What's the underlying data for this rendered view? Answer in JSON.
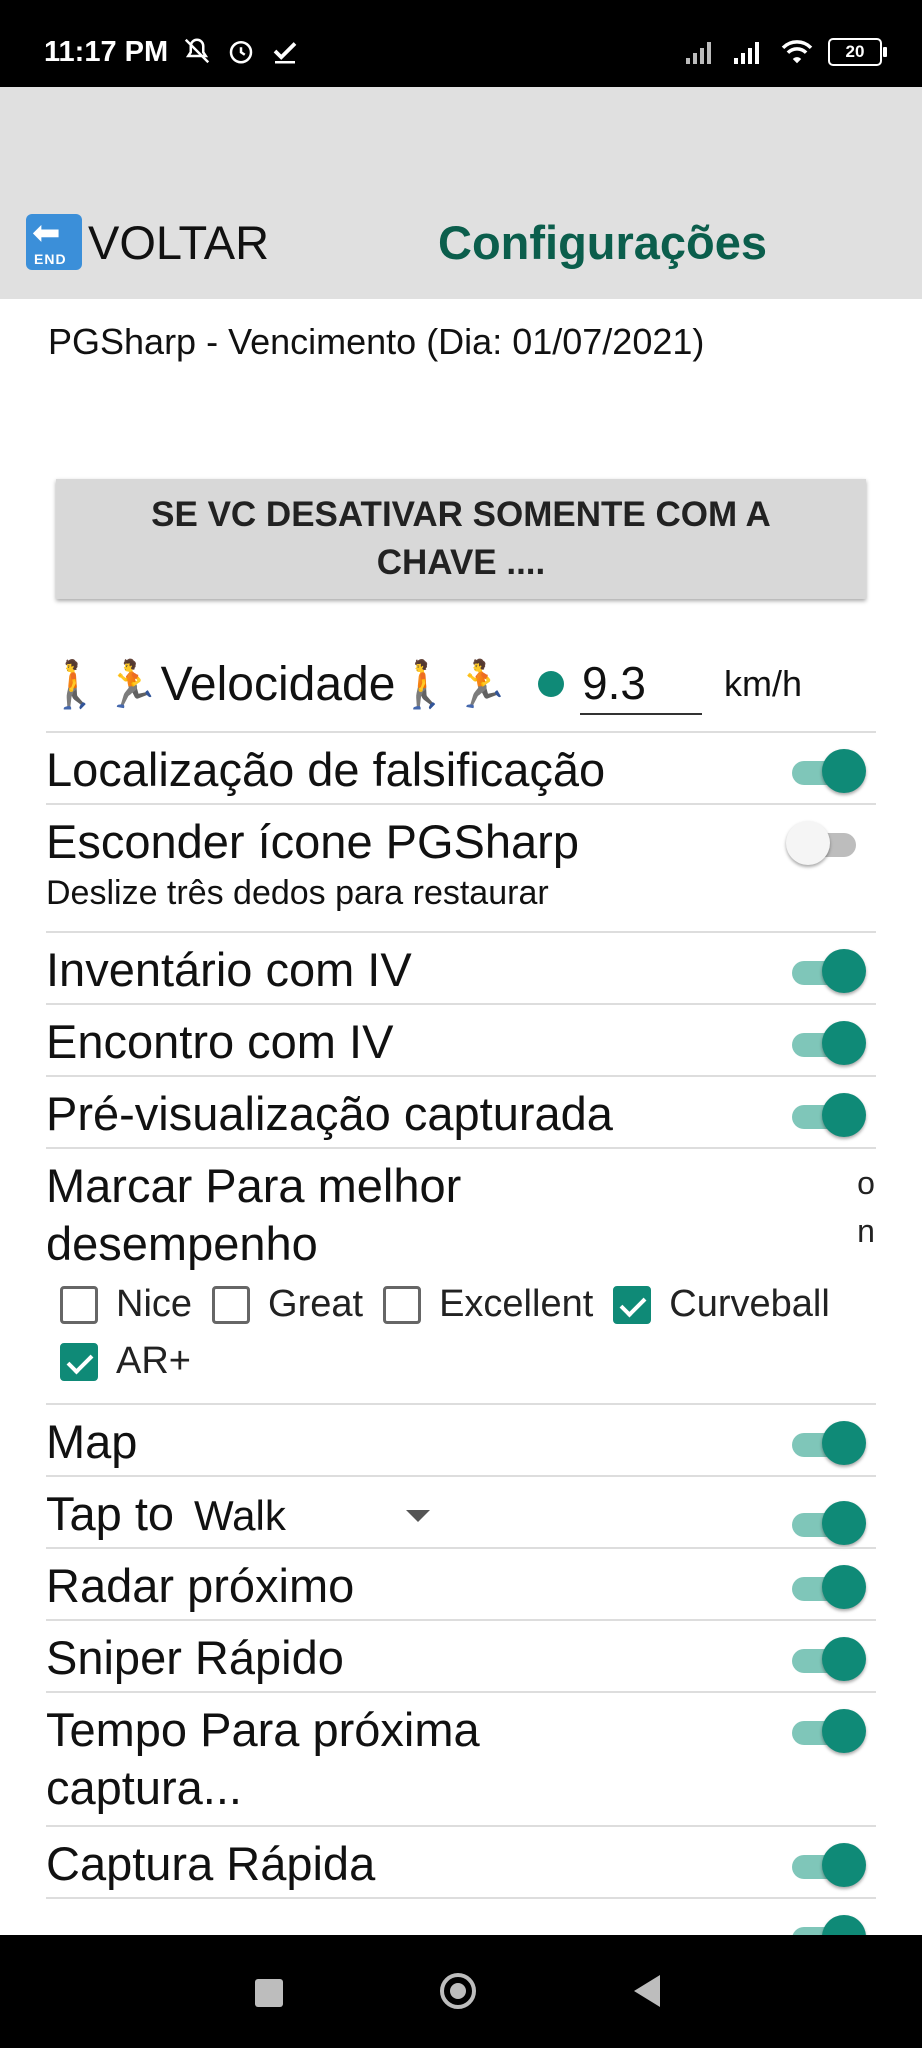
{
  "status": {
    "time": "11:17 PM",
    "battery": "20",
    "icons_left": [
      "muted-icon",
      "alarm-icon",
      "check-icon"
    ],
    "icons_right": [
      "signal-icon",
      "signal-icon",
      "wifi-icon",
      "battery-icon"
    ]
  },
  "header": {
    "back_icon_text": "END",
    "back_label": "VOLTAR",
    "title": "Configurações"
  },
  "content": {
    "expiry": "PGSharp - Vencimento (Dia: 01/07/2021)",
    "deactivate_button": "SE VC DESATIVAR SOMENTE COM A CHAVE ....",
    "speed": {
      "label": "Velocidade",
      "value": "9.3",
      "unit": "km/h"
    },
    "rows": {
      "spoof": {
        "label": "Localização de falsificação",
        "on": true
      },
      "hide_icon": {
        "label": "Esconder ícone PGSharp",
        "sub": "Deslize três dedos para restaurar",
        "on": false
      },
      "inventory_iv": {
        "label": "Inventário com IV",
        "on": true
      },
      "encounter_iv": {
        "label": "Encontro com  IV",
        "on": true
      },
      "preview": {
        "label": "Pré-visualização capturada",
        "on": true
      },
      "mark": {
        "label": "Marcar Para melhor desempenho",
        "on_text": "o\nn"
      },
      "map": {
        "label": "Map",
        "on": true
      },
      "tap_to": {
        "label": "Tap to",
        "option": "Walk",
        "on": true
      },
      "radar": {
        "label": "Radar próximo",
        "on": true
      },
      "sniper": {
        "label": "Sniper Rápido",
        "on": true
      },
      "next_capture": {
        "label": "Tempo Para próxima captura...",
        "on": true
      },
      "quick_catch": {
        "label": "Captura Rápida",
        "on": true
      }
    },
    "checks": [
      {
        "label": "Nice",
        "checked": false
      },
      {
        "label": "Great",
        "checked": false
      },
      {
        "label": "Excellent",
        "checked": false
      },
      {
        "label": "Curveball",
        "checked": true
      },
      {
        "label": "AR+",
        "checked": true
      }
    ]
  },
  "colors": {
    "accent": "#0f8a77",
    "title": "#0b5e4c",
    "header_bg": "#e0e0e0"
  }
}
